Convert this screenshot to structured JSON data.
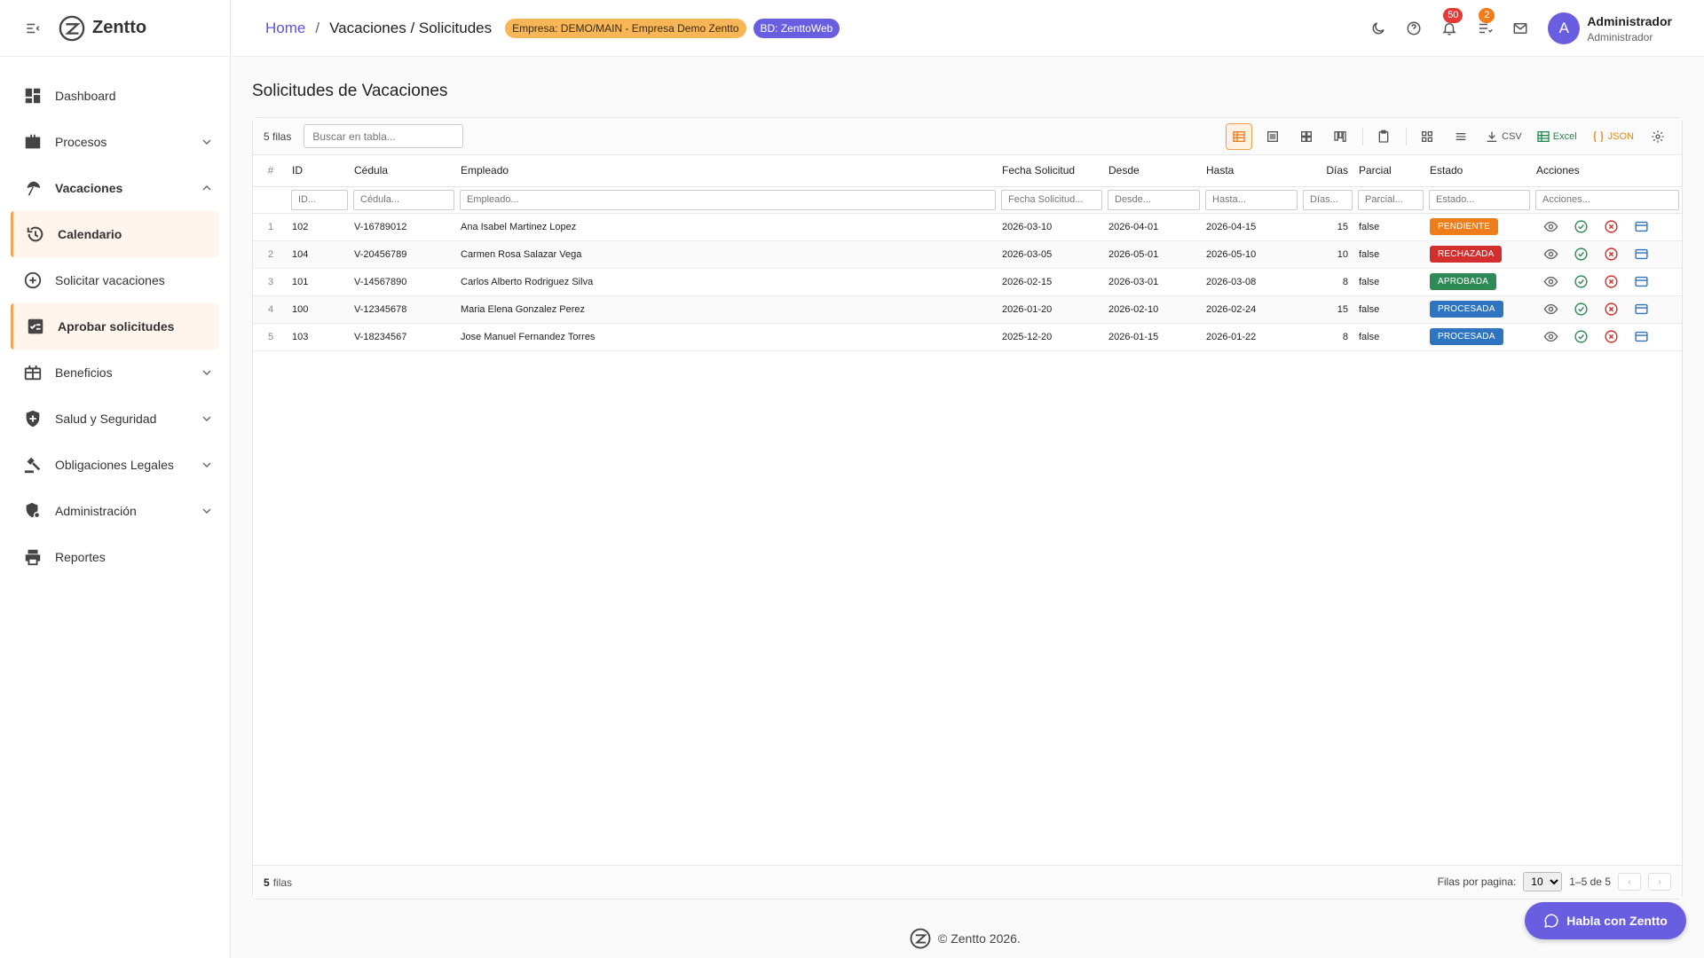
{
  "brand": {
    "name": "Zentto"
  },
  "sidebar": {
    "items": [
      {
        "label": "Dashboard",
        "icon": "dashboard-icon"
      },
      {
        "label": "Procesos",
        "icon": "briefcase-icon",
        "chevron": "chevron-down"
      },
      {
        "label": "Vacaciones",
        "icon": "beach-icon",
        "chevron": "chevron-up"
      },
      {
        "label": "Calendario",
        "icon": "history-icon"
      },
      {
        "label": "Solicitar vacaciones",
        "icon": "add-circle-icon"
      },
      {
        "label": "Aprobar solicitudes",
        "icon": "checklist-icon"
      },
      {
        "label": "Beneficios",
        "icon": "gift-card-icon",
        "chevron": "chevron-down"
      },
      {
        "label": "Salud y Seguridad",
        "icon": "shield-icon",
        "chevron": "chevron-down"
      },
      {
        "label": "Obligaciones Legales",
        "icon": "gavel-icon",
        "chevron": "chevron-down"
      },
      {
        "label": "Administración",
        "icon": "admin-icon",
        "chevron": "chevron-down"
      },
      {
        "label": "Reportes",
        "icon": "print-icon"
      }
    ]
  },
  "topbar": {
    "breadcrumb_home": "Home",
    "breadcrumb_sep": "/",
    "breadcrumb_current": "Vacaciones / Solicitudes",
    "empresa_badge": "Empresa: DEMO/MAIN - Empresa Demo Zentto",
    "bd_badge": "BD: ZenttoWeb",
    "notifications_count": "50",
    "tasks_count": "2",
    "avatar_letter": "A",
    "user_name": "Administrador",
    "user_role": "Administrador"
  },
  "page": {
    "title": "Solicitudes de Vacaciones"
  },
  "grid": {
    "rows_label": "5 filas",
    "search_placeholder": "Buscar en tabla...",
    "toolbar": {
      "csv_label": "CSV",
      "excel_label": "Excel",
      "json_label": "JSON"
    },
    "columns": [
      "#",
      "ID",
      "Cédula",
      "Empleado",
      "Fecha Solicitud",
      "Desde",
      "Hasta",
      "Días",
      "Parcial",
      "Estado",
      "Acciones"
    ],
    "filters": [
      "ID...",
      "Cédula...",
      "Empleado...",
      "Fecha Solicitud...",
      "Desde...",
      "Hasta...",
      "Días...",
      "Parcial...",
      "Estado...",
      "Acciones..."
    ],
    "rows": [
      {
        "n": "1",
        "id": "102",
        "cedula": "V-16789012",
        "empleado": "Ana Isabel Martinez Lopez",
        "fecha": "2026-03-10",
        "desde": "2026-04-01",
        "hasta": "2026-04-15",
        "dias": "15",
        "parcial": "false",
        "estado": "PENDIENTE",
        "estado_color": "#ef7d1b"
      },
      {
        "n": "2",
        "id": "104",
        "cedula": "V-20456789",
        "empleado": "Carmen Rosa Salazar Vega",
        "fecha": "2026-03-05",
        "desde": "2026-05-01",
        "hasta": "2026-05-10",
        "dias": "10",
        "parcial": "false",
        "estado": "RECHAZADA",
        "estado_color": "#d32f2f"
      },
      {
        "n": "3",
        "id": "101",
        "cedula": "V-14567890",
        "empleado": "Carlos Alberto Rodriguez Silva",
        "fecha": "2026-02-15",
        "desde": "2026-03-01",
        "hasta": "2026-03-08",
        "dias": "8",
        "parcial": "false",
        "estado": "APROBADA",
        "estado_color": "#2e8b57"
      },
      {
        "n": "4",
        "id": "100",
        "cedula": "V-12345678",
        "empleado": "Maria Elena Gonzalez Perez",
        "fecha": "2026-01-20",
        "desde": "2026-02-10",
        "hasta": "2026-02-24",
        "dias": "15",
        "parcial": "false",
        "estado": "PROCESADA",
        "estado_color": "#2f74c0"
      },
      {
        "n": "5",
        "id": "103",
        "cedula": "V-18234567",
        "empleado": "Jose Manuel Fernandez Torres",
        "fecha": "2025-12-20",
        "desde": "2026-01-15",
        "hasta": "2026-01-22",
        "dias": "8",
        "parcial": "false",
        "estado": "PROCESADA",
        "estado_color": "#2f74c0"
      }
    ],
    "footer_count": "5",
    "footer_rows_word": "filas",
    "per_page_label": "Filas por pagina:",
    "per_page_value": "10",
    "range_label": "1–5 de 5"
  },
  "footer": {
    "copyright": "© Zentto 2026."
  },
  "chat": {
    "label": "Habla con Zentto"
  },
  "colors": {
    "accent": "#6a5ee0",
    "active_bg": "#fff5ec",
    "active_border": "#f5a45a"
  }
}
